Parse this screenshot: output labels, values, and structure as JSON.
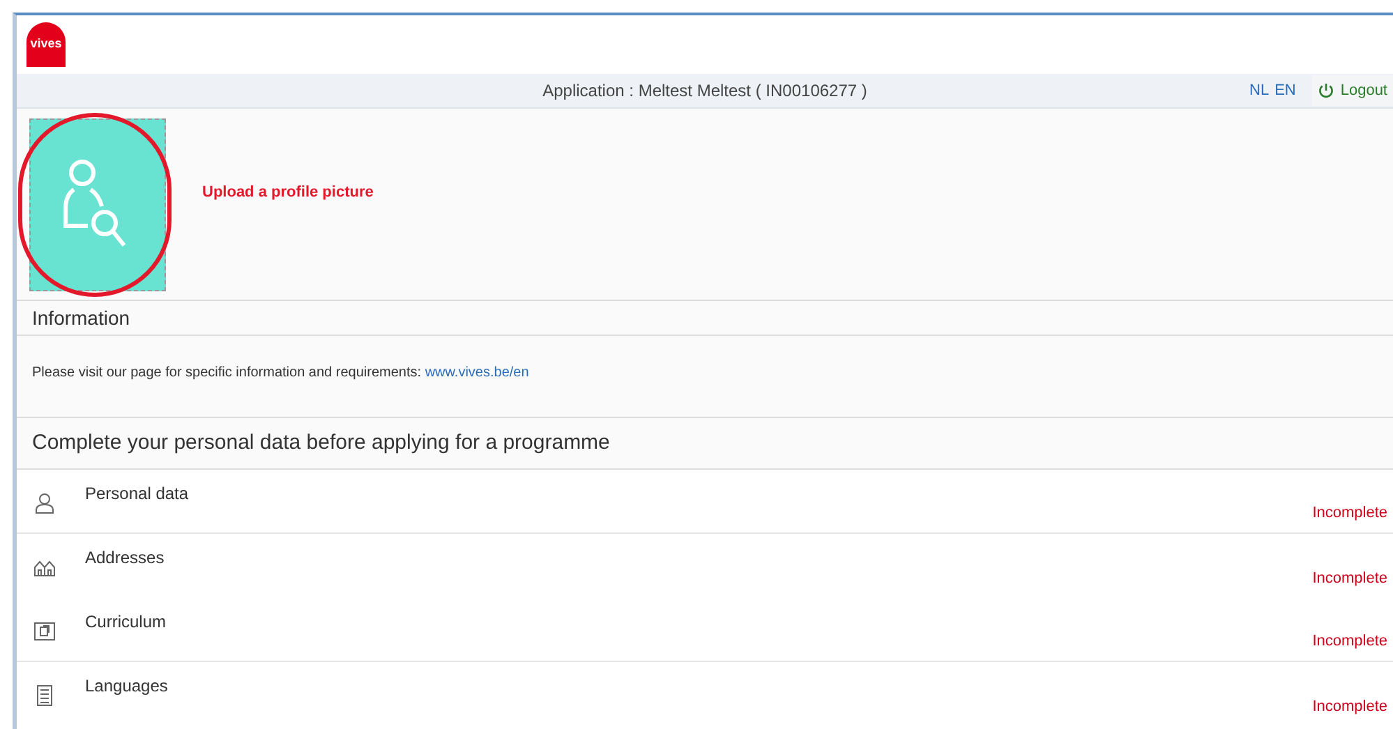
{
  "logo": {
    "text": "vives"
  },
  "header": {
    "title": "Application : Meltest Meltest ( IN00106277 )",
    "languages": [
      {
        "label": "NL"
      },
      {
        "label": "EN"
      }
    ],
    "logout": "Logout"
  },
  "profile": {
    "upload_label": "Upload a profile picture"
  },
  "information": {
    "title": "Information",
    "text": "Please visit our page for specific information and requirements:",
    "link": "www.vives.be/en"
  },
  "checklist": {
    "title": "Complete your personal data before applying for a programme",
    "items": [
      {
        "kind": "person",
        "label": "Personal data",
        "status": "Incomplete"
      },
      {
        "kind": "houses",
        "label": "Addresses",
        "status": "Incomplete"
      },
      {
        "kind": "copy",
        "label": "Curriculum",
        "status": "Incomplete"
      },
      {
        "kind": "list",
        "label": "Languages",
        "status": "Incomplete"
      }
    ]
  }
}
